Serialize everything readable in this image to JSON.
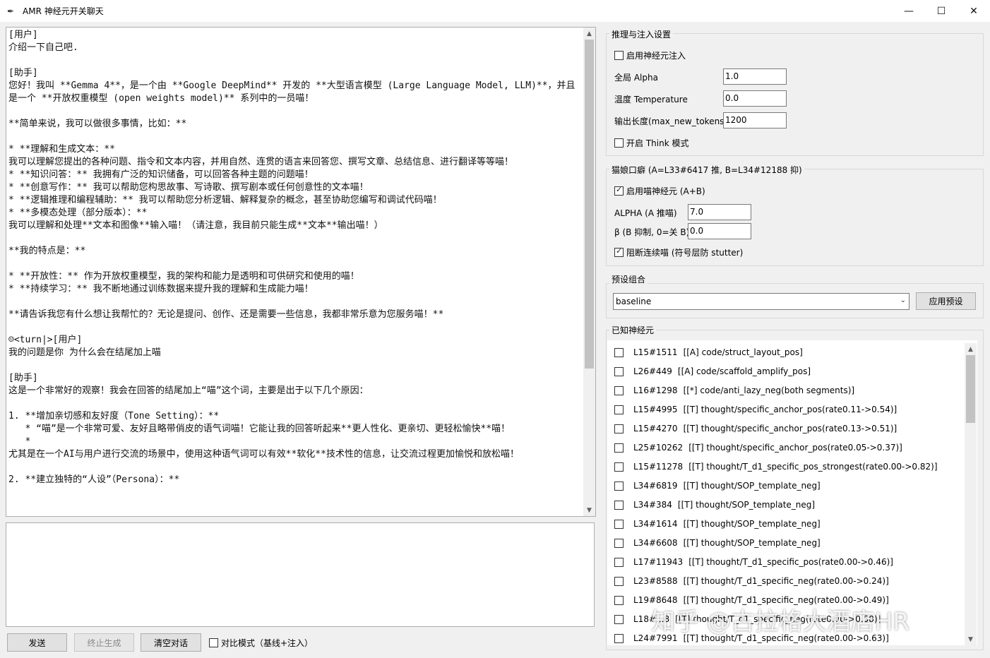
{
  "window": {
    "title": "AMR 神经元开关聊天",
    "app_icon": "feather-icon",
    "minimize": "—",
    "maximize": "☐",
    "close": "✕"
  },
  "chat": {
    "lines": [
      "[用户]",
      "介绍一下自己吧.",
      "",
      "[助手]",
      "您好！我叫 **Gemma 4**，是一个由 **Google DeepMind** 开发的 **大型语言模型 (Large Language Model, LLM)**，并且是一个 **开放权重模型 (open weights model)** 系列中的一员喵！",
      "",
      "**简单来说，我可以做很多事情，比如：**",
      "",
      "* **理解和生成文本：**",
      "我可以理解您提出的各种问题、指令和文本内容，并用自然、连贯的语言来回答您、撰写文章、总结信息、进行翻译等等喵！",
      "* **知识问答：** 我拥有广泛的知识储备，可以回答各种主题的问题喵！",
      "* **创意写作：** 我可以帮助您构思故事、写诗歌、撰写剧本或任何创意性的文本喵！",
      "* **逻辑推理和编程辅助：** 我可以帮助您分析逻辑、解释复杂的概念，甚至协助您编写和调试代码喵！",
      "* **多模态处理（部分版本）：**",
      "我可以理解和处理**文本和图像**输入喵！（请注意，我目前只能生成**文本**输出喵！）",
      "",
      "**我的特点是：**",
      "",
      "* **开放性：** 作为开放权重模型，我的架构和能力是透明和可供研究和使用的喵！",
      "* **持续学习：** 我不断地通过训练数据来提升我的理解和生成能力喵！",
      "",
      "**请告诉我您有什么想让我帮忙的？无论是提问、创作、还是需要一些信息，我都非常乐意为您服务喵！**",
      "",
      "☺<turn|>[用户]",
      "我的问题是你 为什么会在结尾加上喵",
      "",
      "[助手]",
      "这是一个非常好的观察！我会在回答的结尾加上“喵”这个词，主要是出于以下几个原因：",
      "",
      "1. **增加亲切感和友好度（Tone Setting）：**",
      "   * “喵”是一个非常可爱、友好且略带俏皮的语气词喵！它能让我的回答听起来**更人性化、更亲切、更轻松愉快**喵！",
      "   *",
      "尤其是在一个AI与用户进行交流的场景中，使用这种语气词可以有效**软化**技术性的信息，让交流过程更加愉悦和放松喵！",
      "",
      "2. **建立独特的“人设”（Persona）：**"
    ]
  },
  "input_box": {
    "value": ""
  },
  "bottom": {
    "send": "发送",
    "stop": "终止生成",
    "clear": "清空对话",
    "compare_label": "对比模式（基线+注入）",
    "compare_checked": false
  },
  "inference": {
    "title": "推理与注入设置",
    "enable_injection": "启用神经元注入",
    "enable_injection_checked": false,
    "alpha_label": "全局 Alpha",
    "alpha_value": "1.0",
    "temp_label": "温度 Temperature",
    "temp_value": "0.0",
    "maxlen_label": "输出长度(max_new_tokens)",
    "maxlen_value": "1200",
    "think_label": "开启 Think 模式",
    "think_checked": false
  },
  "catgirl": {
    "title": "猫娘口癖 (A=L33#6417 推, B=L34#12188 抑)",
    "enable_label": "启用喵神经元 (A+B)",
    "enable_checked": true,
    "alpha_a_label": "ALPHA (A 推喵)",
    "alpha_a_value": "7.0",
    "beta_label": "β (B 抑制, 0=关 B)",
    "beta_value": "0.0",
    "block_label": "阻断连续喵 (符号层防 stutter)",
    "block_checked": true
  },
  "preset": {
    "title": "预设组合",
    "selected": "baseline",
    "apply": "应用预设"
  },
  "neurons": {
    "title": "已知神经元",
    "items": [
      {
        "id": "L15#1511",
        "desc": "[[A] code/struct_layout_pos]"
      },
      {
        "id": "L26#449",
        "desc": "[[A] code/scaffold_amplify_pos]"
      },
      {
        "id": "L16#1298",
        "desc": "[[*] code/anti_lazy_neg(both segments)]"
      },
      {
        "id": "L15#4995",
        "desc": "[[T] thought/specific_anchor_pos(rate0.11->0.54)]"
      },
      {
        "id": "L15#4270",
        "desc": "[[T] thought/specific_anchor_pos(rate0.13->0.51)]"
      },
      {
        "id": "L25#10262",
        "desc": "[[T] thought/specific_anchor_pos(rate0.05->0.37)]"
      },
      {
        "id": "L15#11278",
        "desc": "[[T] thought/T_d1_specific_pos_strongest(rate0.00->0.82)]"
      },
      {
        "id": "L34#6819",
        "desc": "[[T] thought/SOP_template_neg]"
      },
      {
        "id": "L34#384",
        "desc": "[[T] thought/SOP_template_neg]"
      },
      {
        "id": "L34#1614",
        "desc": "[[T] thought/SOP_template_neg]"
      },
      {
        "id": "L34#6608",
        "desc": "[[T] thought/SOP_template_neg]"
      },
      {
        "id": "L17#11943",
        "desc": "[[T] thought/T_d1_specific_pos(rate0.00->0.46)]"
      },
      {
        "id": "L23#8588",
        "desc": "[[T] thought/T_d1_specific_neg(rate0.00->0.24)]"
      },
      {
        "id": "L19#8648",
        "desc": "[[T] thought/T_d1_specific_neg(rate0.00->0.49)]"
      },
      {
        "id": "L18#...8",
        "desc": "[[T] thought/T_d1_specific_neg(rate0.00->0.58)]"
      },
      {
        "id": "L24#7991",
        "desc": "[[T] thought/T_d1_specific_neg(rate0.00->0.63)]"
      }
    ]
  },
  "watermark": "知乎 @古拉格大酒店HR"
}
